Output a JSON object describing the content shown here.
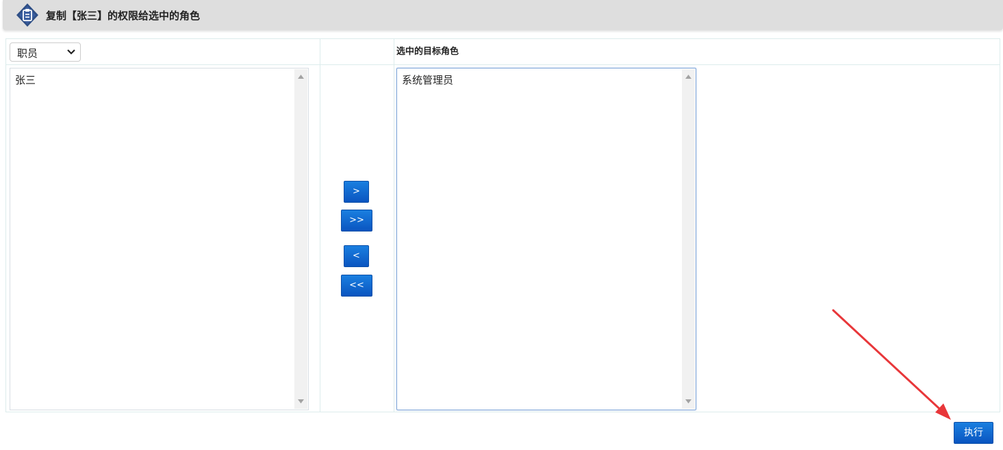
{
  "header": {
    "title": "复制【张三】的权限给选中的角色",
    "icon": "clipboard-icon"
  },
  "filter": {
    "selected": "职员"
  },
  "target_header": "选中的目标角色",
  "source_list": {
    "items": [
      "张三"
    ]
  },
  "target_list": {
    "items": [
      "系统管理员"
    ]
  },
  "buttons": {
    "move_right": ">",
    "move_all_right": ">>",
    "move_left": "<",
    "move_all_left": "<<",
    "execute": "执行"
  },
  "colors": {
    "accent": "#0a6fd6",
    "annotation": "#e8373a"
  }
}
